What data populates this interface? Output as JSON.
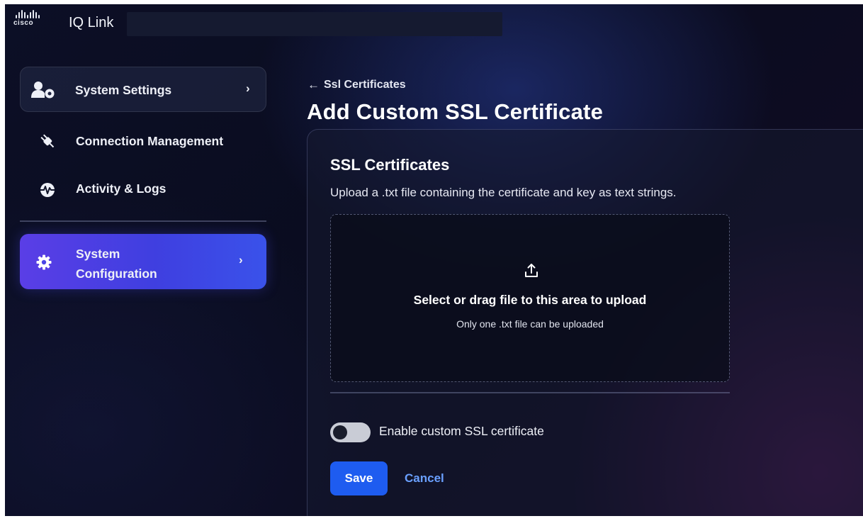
{
  "header": {
    "logo_text": "cisco",
    "app_title": "IQ Link"
  },
  "sidebar": {
    "items": [
      {
        "label": "System Settings",
        "icon": "user-settings-icon",
        "has_chevron": true
      },
      {
        "label": "Connection Management",
        "icon": "plug-icon"
      },
      {
        "label": "Activity & Logs",
        "icon": "activity-icon"
      },
      {
        "label": "System Configuration",
        "icon": "gear-icon",
        "has_chevron": true,
        "active": true
      }
    ]
  },
  "breadcrumb": {
    "back_label": "Ssl Certificates"
  },
  "page": {
    "title": "Add Custom SSL Certificate"
  },
  "card": {
    "title": "SSL Certificates",
    "description": "Upload a .txt file containing the certificate and key as text strings.",
    "dropzone": {
      "title": "Select or drag file to this area to upload",
      "subtitle": "Only one .txt file can be uploaded",
      "icon": "upload-icon"
    },
    "toggle": {
      "label": "Enable custom SSL certificate",
      "enabled": false
    },
    "save_label": "Save",
    "cancel_label": "Cancel"
  },
  "colors": {
    "accent": "#1e5cf0",
    "link": "#6aa0ff",
    "active_nav": "#4a45e6",
    "background": "#0c0f26"
  }
}
